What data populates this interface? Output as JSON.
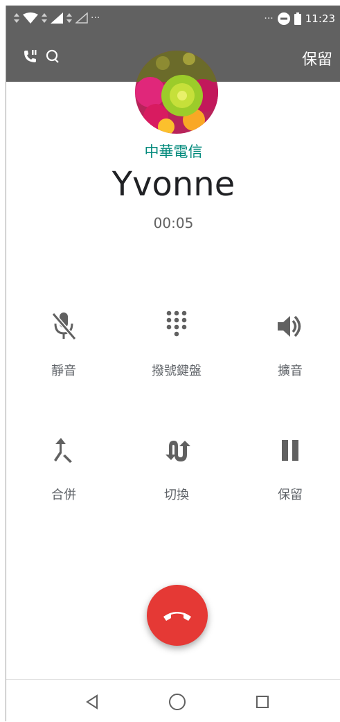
{
  "statusbar": {
    "overflow": "···",
    "clock": "11:23"
  },
  "appbar": {
    "hold_label": "保留",
    "icons": [
      "phone-wifi-icon",
      "search-icon"
    ]
  },
  "call": {
    "carrier": "中華電信",
    "name": "Yvonne",
    "duration": "00:05"
  },
  "controls": [
    {
      "label": "靜音",
      "icon": "mic-off-icon"
    },
    {
      "label": "撥號鍵盤",
      "icon": "dialpad-icon"
    },
    {
      "label": "擴音",
      "icon": "speaker-icon"
    },
    {
      "label": "合併",
      "icon": "merge-icon"
    },
    {
      "label": "切換",
      "icon": "swap-icon"
    },
    {
      "label": "保留",
      "icon": "pause-icon"
    }
  ],
  "colors": {
    "bar": "#616161",
    "accent": "#00897b",
    "end_call": "#e53935"
  },
  "nav": [
    "back-icon",
    "home-icon",
    "recents-icon"
  ]
}
